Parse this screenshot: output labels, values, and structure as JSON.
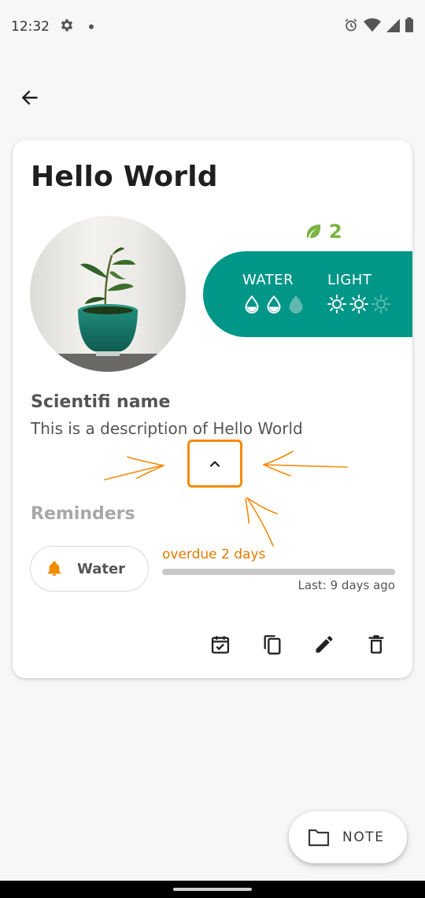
{
  "status_bar": {
    "time": "12:32",
    "icons": [
      "settings-icon",
      "notification-dot-icon",
      "alarm-icon",
      "wifi-icon",
      "signal-icon",
      "battery-icon"
    ]
  },
  "app_bar": {
    "back_icon": "arrow-back-icon"
  },
  "plant": {
    "title": "Hello World",
    "leaf_count": "2",
    "scientific_name": "Scientifi name",
    "description": "This is a description of Hello World"
  },
  "care": {
    "water_label": "WATER",
    "light_label": "LIGHT",
    "water_level": 2,
    "water_max": 3,
    "light_level": 2,
    "light_max": 3
  },
  "reminders": {
    "heading": "Reminders",
    "items": [
      {
        "label": "Water",
        "status": "overdue 2 days",
        "last": "Last: 9 days ago",
        "progress": 1.0
      }
    ]
  },
  "actions": [
    "calendar-check-icon",
    "copy-icon",
    "edit-icon",
    "delete-icon"
  ],
  "fab": {
    "label": "NOTE",
    "icon": "folder-icon"
  },
  "colors": {
    "accent": "#009688",
    "leaf": "#7cb342",
    "overdue": "#e07b00",
    "annotation": "#f58a0a"
  }
}
